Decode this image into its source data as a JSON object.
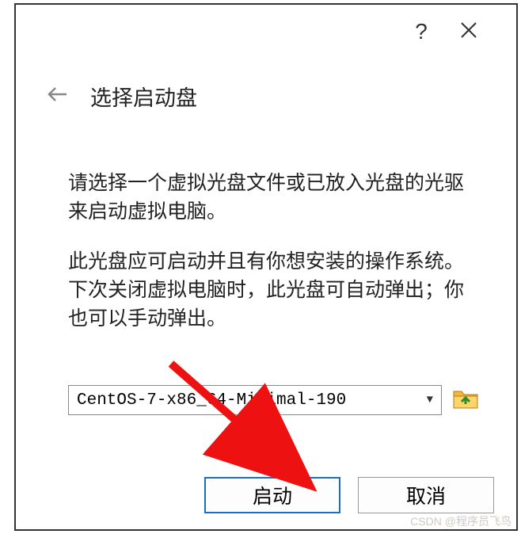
{
  "titlebar": {
    "help_label": "?",
    "close_label": "×"
  },
  "dialog": {
    "title": "选择启动盘",
    "paragraph1": "请选择一个虚拟光盘文件或已放入光盘的光驱来启动虚拟电脑。",
    "paragraph2": "此光盘应可启动并且有你想安装的操作系统。下次关闭虚拟电脑时，此光盘可自动弹出；你也可以手动弹出。"
  },
  "selector": {
    "value": "CentOS-7-x86_64-Minimal-190",
    "dropdown_icon": "▼"
  },
  "buttons": {
    "primary": "启动",
    "cancel": "取消"
  },
  "watermark": "CSDN @程序员飞鸟"
}
